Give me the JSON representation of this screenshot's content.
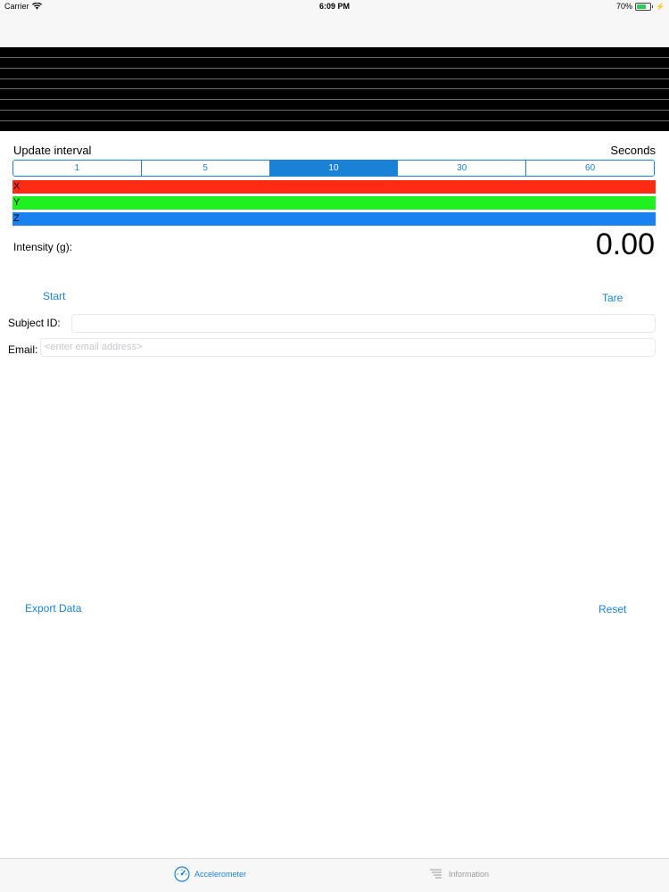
{
  "status_bar": {
    "carrier": "Carrier",
    "time": "6:09 PM",
    "battery_pct": "70%",
    "battery_level": 0.7
  },
  "update_interval": {
    "label": "Update interval",
    "unit_label": "Seconds",
    "options": [
      "1",
      "5",
      "10",
      "30",
      "60"
    ],
    "selected": "10"
  },
  "axes": [
    {
      "label": "X",
      "color": "#ff2b13"
    },
    {
      "label": "Y",
      "color": "#1ff01f"
    },
    {
      "label": "Z",
      "color": "#1a82f0"
    }
  ],
  "intensity": {
    "label": "Intensity (g):",
    "value": "0.00"
  },
  "buttons": {
    "start": "Start",
    "tare": "Tare",
    "export": "Export Data",
    "reset": "Reset"
  },
  "form": {
    "subject_label": "Subject ID:",
    "subject_value": "",
    "email_label": "Email:",
    "email_placeholder": "<enter email address>"
  },
  "tabs": [
    {
      "label": "Accelerometer",
      "icon": "speedometer-icon",
      "active": true
    },
    {
      "label": "Information",
      "icon": "lines-icon",
      "active": false
    }
  ],
  "colors": {
    "accent": "#1a82d6",
    "graph_bg": "#000000"
  }
}
